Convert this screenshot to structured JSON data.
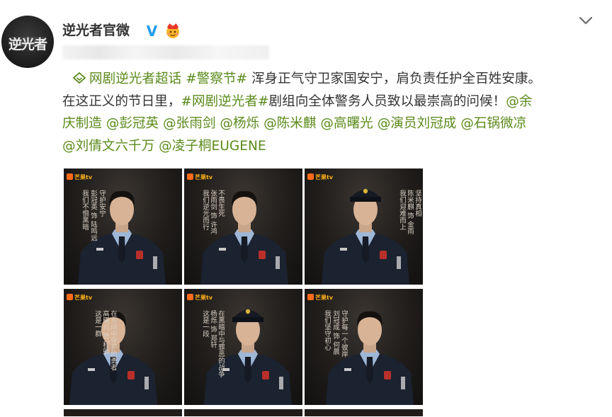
{
  "account": {
    "name": "逆光者官微",
    "avatar_text": "逆光者",
    "verified_icon": "verified-v-icon",
    "badge_icon": "crown-emoji-icon"
  },
  "post": {
    "topic_icon": "topic-link-icon",
    "line1": {
      "link1": "网剧逆光者超话",
      "space": " ",
      "tag1": "#警察节#",
      "text1": " 浑身正气守卫家国安宁，肩负责任护全百姓安康。"
    },
    "line2": {
      "text1": "在这正义的节日里，",
      "tag2": "#网剧逆光者#",
      "text2": "剧组向全体警务人员致以最崇高的问候！",
      "m1a": "@余"
    },
    "line3": {
      "m1b": "庆制造",
      "m2": "@彭冠英",
      "m3": "@张雨剑",
      "m4": "@杨烁",
      "m5": "@陈米麒",
      "m6": "@高曙光",
      "m7": "@演员刘冠成",
      "m8": "@石锅微凉"
    },
    "line4": {
      "m9": "@刘倩文六千万",
      "m10": "@凌子桐EUGENE"
    }
  },
  "images": {
    "logo_text": "芒果tv",
    "tiles": [
      {
        "t1": "我们不惧黑暗",
        "t2": "守护安宁",
        "t3": "彭冠英 饰 陆鸣远"
      },
      {
        "t1": "我们逆光而行",
        "t2": "不畏生死",
        "t3": "张雨剑 饰 许鸿"
      },
      {
        "t1": "我们迎难而上",
        "t2": "坚持真相",
        "t3": "陈米麒 饰 金雨"
      },
      {
        "t1": "这是一群",
        "t2": "在方向中守护的勇者",
        "t3": "高曙光 饰 程骁"
      },
      {
        "t1": "这是一段",
        "t2": "在黑暗中与罪恶的战争",
        "t3": "杨烁 饰 郑轩"
      },
      {
        "t1": "我们坚守初心",
        "t2": "守护每一个彼岸",
        "t3": "刘冠成 饰 何晨"
      }
    ]
  },
  "colors": {
    "link": "#5a8a1a",
    "text": "#333333",
    "verified": "#1d9bf0"
  }
}
